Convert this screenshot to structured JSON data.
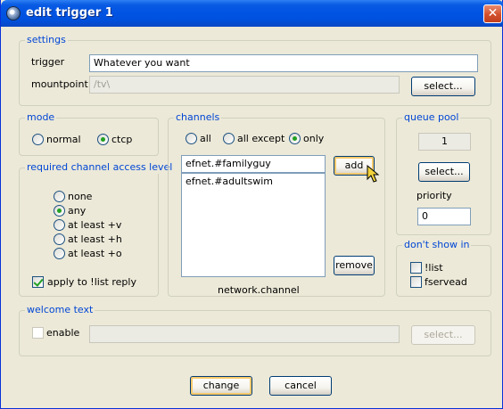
{
  "window": {
    "title": "edit trigger 1",
    "icon": "app-icon",
    "close_glyph": "✕"
  },
  "settings": {
    "legend": "settings",
    "trigger_label": "trigger",
    "trigger_value": "Whatever you want",
    "mountpoint_label": "mountpoint",
    "mountpoint_value": "/tv\\",
    "select_label": "select..."
  },
  "mode": {
    "legend": "mode",
    "options": [
      {
        "label": "normal",
        "selected": false
      },
      {
        "label": "ctcp",
        "selected": true
      }
    ]
  },
  "access": {
    "legend": "required channel access level",
    "options": [
      {
        "label": "none",
        "selected": false
      },
      {
        "label": "any",
        "selected": true
      },
      {
        "label": "at least +v",
        "selected": false
      },
      {
        "label": "at least +h",
        "selected": false
      },
      {
        "label": "at least +o",
        "selected": false
      }
    ],
    "apply_label": "apply to !list reply",
    "apply_checked": true
  },
  "channels": {
    "legend": "channels",
    "options": [
      {
        "label": "all",
        "selected": false
      },
      {
        "label": "all except",
        "selected": false
      },
      {
        "label": "only",
        "selected": true
      }
    ],
    "entry_value": "efnet.#familyguy",
    "add_label": "add",
    "remove_label": "remove",
    "items": [
      "efnet.#adultswim"
    ],
    "hint": "network.channel"
  },
  "queue": {
    "legend": "queue pool",
    "pool_value": "1",
    "select_label": "select...",
    "priority_label": "priority",
    "priority_value": "0"
  },
  "dontshow": {
    "legend": "don't show in",
    "options": [
      {
        "label": "!list",
        "checked": false
      },
      {
        "label": "fservead",
        "checked": false
      }
    ]
  },
  "welcome": {
    "legend": "welcome text",
    "enable_label": "enable",
    "enable_checked": false,
    "text_value": "",
    "select_label": "select..."
  },
  "footer": {
    "change_label": "change",
    "cancel_label": "cancel"
  },
  "colors": {
    "legend_text": "#0046d5",
    "titlebar": "#0054e3",
    "dialog_bg": "#ece9d8",
    "radio_dot": "#21a121"
  }
}
